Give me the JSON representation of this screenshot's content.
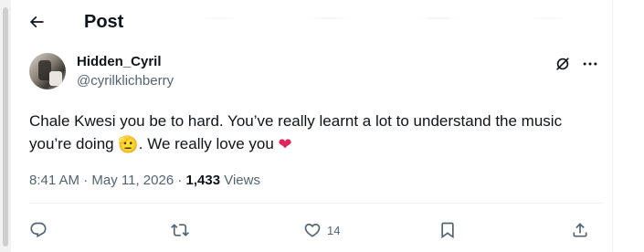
{
  "header": {
    "title": "Post"
  },
  "post": {
    "display_name": "Hidden_Cyril",
    "handle": "@cyrilklichberry",
    "text_before_emoji": "Chale Kwesi you be to hard. You’ve really learnt a lot to understand the music you’re doing ",
    "emoji_1": "🫡",
    "text_middle": ". We really love you ",
    "emoji_2": "❤",
    "time": "8:41 AM",
    "separator_1": "·",
    "date": "May 11, 2026",
    "separator_2": "·",
    "views_count": "1,433",
    "views_label": "Views",
    "likes_count": "14"
  },
  "icons": {
    "back": "arrow-left-icon",
    "grok": "grok-icon",
    "more": "more-icon",
    "reply": "reply-icon",
    "repost": "repost-icon",
    "like": "heart-icon",
    "bookmark": "bookmark-icon",
    "share": "share-icon"
  },
  "colors": {
    "text_primary": "#0f1419",
    "text_secondary": "#536471",
    "divider": "#eff3f4",
    "heart_emoji": "#e0245e"
  }
}
